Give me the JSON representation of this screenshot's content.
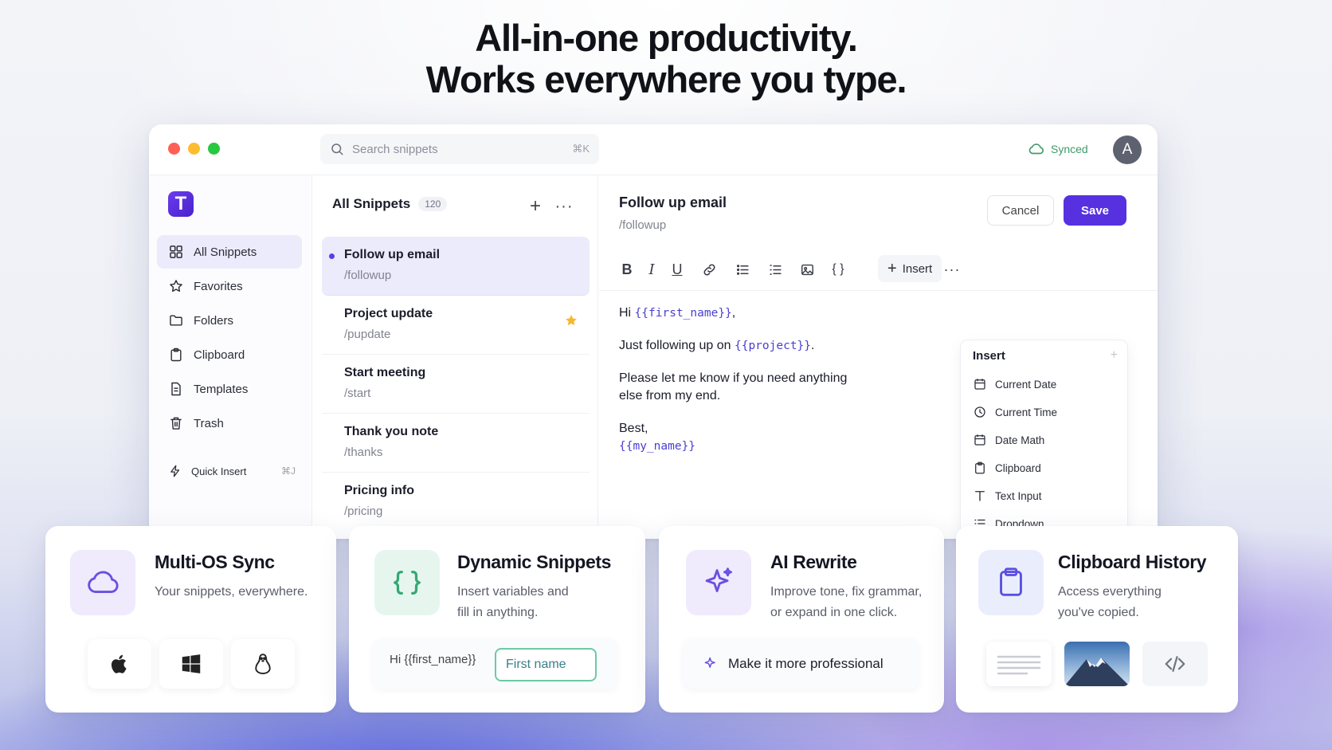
{
  "headline": {
    "line1": "All-in-one productivity.",
    "line2": "Works everywhere you type."
  },
  "window": {
    "search_placeholder": "Search snippets",
    "search_shortcut": "⌘K",
    "sync_status": "Synced",
    "avatar_initial": "A",
    "logo_letter": "T"
  },
  "sidebar": {
    "items": [
      {
        "label": "All Snippets",
        "icon": "grid-icon",
        "active": true
      },
      {
        "label": "Favorites",
        "icon": "star-icon"
      },
      {
        "label": "Folders",
        "icon": "folder-icon"
      },
      {
        "label": "Clipboard",
        "icon": "clipboard-icon"
      },
      {
        "label": "Templates",
        "icon": "document-icon"
      },
      {
        "label": "Trash",
        "icon": "trash-icon"
      }
    ],
    "quick_insert": {
      "label": "Quick Insert",
      "shortcut": "⌘J"
    }
  },
  "list": {
    "title": "All Snippets",
    "count": "120",
    "add_label": "+",
    "more_label": "···",
    "items": [
      {
        "name": "Follow up email",
        "shortcut": "/followup",
        "active": true
      },
      {
        "name": "Project update",
        "shortcut": "/pupdate",
        "starred": true
      },
      {
        "name": "Start meeting",
        "shortcut": "/start"
      },
      {
        "name": "Thank you note",
        "shortcut": "/thanks"
      },
      {
        "name": "Pricing info",
        "shortcut": "/pricing"
      }
    ]
  },
  "editor": {
    "title": "Follow up email",
    "shortcut": "/followup",
    "cancel_label": "Cancel",
    "save_label": "Save",
    "toolbar": {
      "bold": "B",
      "italic": "I",
      "underline": "U",
      "code": "{ }",
      "insert_label": "Insert",
      "more": "···"
    },
    "body": {
      "greet_prefix": "Hi ",
      "var_first_name": "{{first_name}}",
      "greet_suffix": ",",
      "follow_prefix": "Just following up on ",
      "var_project": "{{project}}",
      "follow_suffix": ".",
      "request_line1": "Please let me know if you need anything",
      "request_line2": "else from my end.",
      "signoff": "Best,",
      "var_my_name": "{{my_name}}"
    },
    "insert_panel": {
      "title": "Insert",
      "plus": "+",
      "items": [
        {
          "label": "Current Date",
          "icon": "calendar-icon"
        },
        {
          "label": "Current Time",
          "icon": "clock-icon"
        },
        {
          "label": "Date Math",
          "icon": "calendar-icon"
        },
        {
          "label": "Clipboard",
          "icon": "clipboard-icon"
        },
        {
          "label": "Text Input",
          "icon": "text-icon"
        },
        {
          "label": "Dropdown",
          "icon": "list-icon"
        }
      ]
    }
  },
  "cards": [
    {
      "title": "Multi-OS Sync",
      "desc": "Your snippets, everywhere.",
      "icon": "cloud-icon"
    },
    {
      "title": "Dynamic Snippets",
      "desc_line1": "Insert variables and",
      "desc_line2": "fill in anything.",
      "icon": "braces-icon",
      "demo_text": "Hi {{first_name}}",
      "demo_field": "First name"
    },
    {
      "title": "AI Rewrite",
      "desc_line1": "Improve tone, fix grammar,",
      "desc_line2": "or expand in one click.",
      "icon": "sparkle-icon",
      "action": "Make it more professional"
    },
    {
      "title": "Clipboard History",
      "desc_line1": "Access everything",
      "desc_line2": "you've copied.",
      "icon": "clipboard-icon"
    }
  ],
  "colors": {
    "accent": "#5731e0",
    "sync_green": "#3f9a6a",
    "variable": "#4a3fd0",
    "star": "#f5b82e"
  }
}
